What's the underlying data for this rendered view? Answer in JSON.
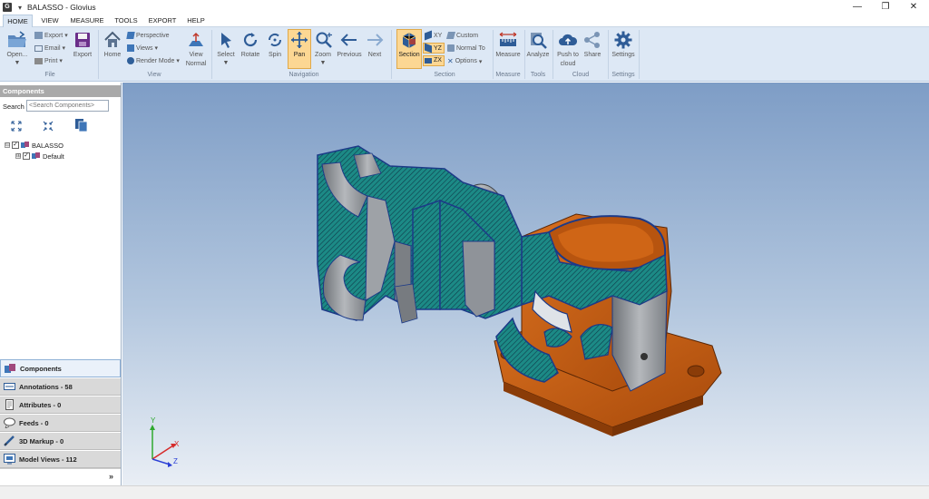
{
  "window": {
    "title": "BALASSO - Glovius",
    "app_icon_glyph": "G",
    "quick_access_glyph": "▾",
    "controls": {
      "minimize": "—",
      "restore": "❐",
      "close": "✕"
    }
  },
  "menu": {
    "tabs": [
      {
        "label": "HOME",
        "active": true
      },
      {
        "label": "VIEW",
        "active": false
      },
      {
        "label": "MEASURE",
        "active": false
      },
      {
        "label": "TOOLS",
        "active": false
      },
      {
        "label": "EXPORT",
        "active": false
      },
      {
        "label": "HELP",
        "active": false
      }
    ]
  },
  "ribbon": {
    "file": {
      "group": "File",
      "open": "Open...",
      "export_menu": "Export",
      "email": "Email",
      "print": "Print",
      "export_btn": "Export"
    },
    "view": {
      "group": "View",
      "home": "Home",
      "perspective": "Perspective",
      "views": "Views",
      "render_mode": "Render Mode",
      "view_normal_1": "View",
      "view_normal_2": "Normal"
    },
    "navigation": {
      "group": "Navigation",
      "select": "Select",
      "rotate": "Rotate",
      "spin": "Spin",
      "pan": "Pan",
      "zoom": "Zoom",
      "previous": "Previous",
      "next": "Next"
    },
    "section": {
      "group": "Section",
      "section": "Section",
      "xy": "XY",
      "yz": "YZ",
      "zx": "ZX",
      "custom": "Custom",
      "normal_to": "Normal To",
      "options": "Options"
    },
    "measure": {
      "group": "Measure",
      "measure": "Measure"
    },
    "tools": {
      "group": "Tools",
      "analyze": "Analyze"
    },
    "cloud": {
      "group": "Cloud",
      "push_1": "Push to",
      "push_2": "cloud",
      "share": "Share"
    },
    "settings": {
      "group": "Settings",
      "settings": "Settings"
    }
  },
  "left_panel": {
    "header": "Components",
    "search_label": "Search :",
    "search_placeholder": "<Search Components>",
    "toolbar_icons": [
      "expand-all-icon",
      "collapse-all-icon",
      "copy-icon"
    ],
    "tree": [
      {
        "label": "BALASSO",
        "checked": true,
        "expander": "⊟"
      },
      {
        "label": "Default",
        "checked": true,
        "expander": "⊞"
      }
    ],
    "nav_buttons": [
      {
        "label": "Components",
        "icon": "components-icon",
        "active": true
      },
      {
        "label": "Annotations - 58",
        "icon": "annotations-icon",
        "active": false
      },
      {
        "label": "Attributes - 0",
        "icon": "attributes-icon",
        "active": false
      },
      {
        "label": "Feeds - 0",
        "icon": "feeds-icon",
        "active": false
      },
      {
        "label": "3D Markup - 0",
        "icon": "markup-icon",
        "active": false
      },
      {
        "label": "Model Views - 112",
        "icon": "model-views-icon",
        "active": false
      }
    ],
    "more": "»"
  },
  "viewport": {
    "axes": {
      "x": "X",
      "y": "Y",
      "z": "Z"
    }
  },
  "colors": {
    "ribbon_bg": "#dde8f5",
    "viewport_top": "#7e9dc6",
    "viewport_bottom": "#e9eef5",
    "part_orange": "#c45a0e",
    "section_teal": "#1c8a86",
    "part_gray": "#8f9296",
    "active_tool": "#fcd793"
  }
}
